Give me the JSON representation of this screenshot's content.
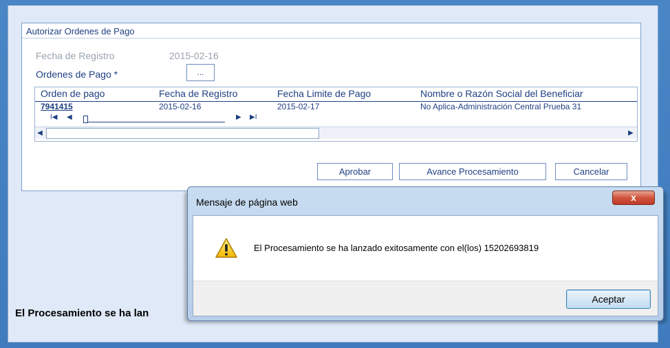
{
  "panel": {
    "title": "Autorizar Ordenes de Pago",
    "fecha_label": "Fecha de Registro",
    "fecha_value": "2015-02-16",
    "ordenes_label": "Ordenes de Pago *",
    "dots_button": "..."
  },
  "grid": {
    "headers": [
      "Orden de pago",
      "Fecha de Registro",
      "Fecha Limite de Pago",
      "Nombre o Razón Social del Beneficiar"
    ],
    "rows": [
      [
        "7941415",
        "2015-02-16",
        "2015-02-17",
        "No Aplica-Administración Central Prueba 31"
      ]
    ],
    "pager": {
      "first": "I◀",
      "prev": "◀",
      "next": "▶",
      "last": "▶I"
    }
  },
  "buttons": {
    "aprobar": "Aprobar",
    "avance": "Avance Procesamiento",
    "cancelar": "Cancelar"
  },
  "status_text": "El Procesamiento se ha lan",
  "dialog": {
    "title": "Mensaje de página web",
    "message": "El Procesamiento se ha lanzado exitosamente con el(los) 15202693819",
    "ok_label": "Aceptar",
    "close_glyph": "x"
  },
  "icons": {
    "warning": "warning-icon",
    "close": "close-icon"
  },
  "colors": {
    "frame_blue": "#4a86c6",
    "text_blue": "#1f3f82",
    "close_red": "#c0392b"
  }
}
